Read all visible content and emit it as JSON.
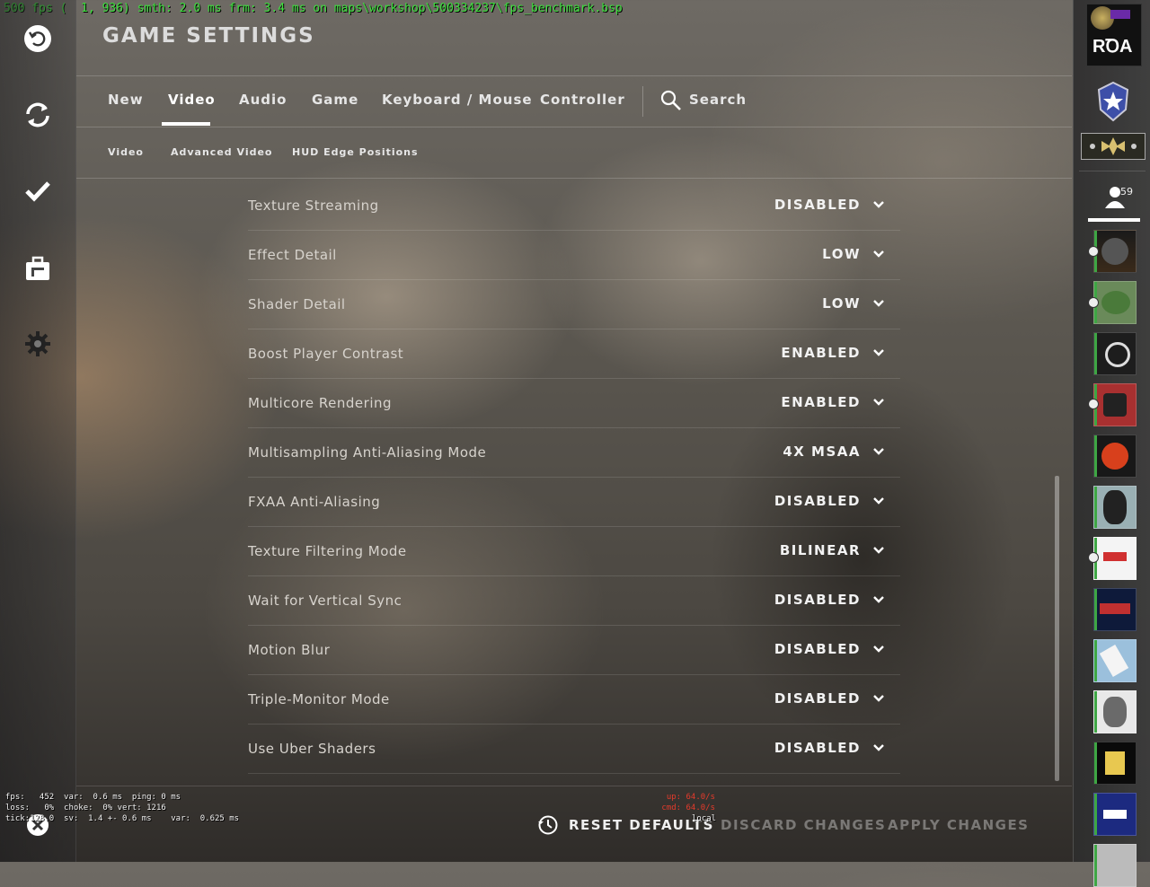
{
  "debug_overlay": "500 fps (  1, 936) smth: 2.0 ms frm: 3.4 ms on maps\\workshop\\500334237\\fps_benchmark.bsp",
  "title": "GAME SETTINGS",
  "tabs": [
    {
      "label": "New"
    },
    {
      "label": "Video",
      "active": true
    },
    {
      "label": "Audio"
    },
    {
      "label": "Game"
    },
    {
      "label": "Keyboard / Mouse"
    },
    {
      "label": "Controller"
    }
  ],
  "search": {
    "label": "Search",
    "icon": "search-icon"
  },
  "subtabs": [
    {
      "label": "Video"
    },
    {
      "label": "Advanced Video",
      "active": true
    },
    {
      "label": "HUD Edge Positions"
    }
  ],
  "settings": [
    {
      "label": "Texture Streaming",
      "value": "DISABLED"
    },
    {
      "label": "Effect Detail",
      "value": "LOW"
    },
    {
      "label": "Shader Detail",
      "value": "LOW"
    },
    {
      "label": "Boost Player Contrast",
      "value": "ENABLED"
    },
    {
      "label": "Multicore Rendering",
      "value": "ENABLED"
    },
    {
      "label": "Multisampling Anti-Aliasing Mode",
      "value": "4X MSAA"
    },
    {
      "label": "FXAA Anti-Aliasing",
      "value": "DISABLED"
    },
    {
      "label": "Texture Filtering Mode",
      "value": "BILINEAR"
    },
    {
      "label": "Wait for Vertical Sync",
      "value": "DISABLED"
    },
    {
      "label": "Motion Blur",
      "value": "DISABLED"
    },
    {
      "label": "Triple-Monitor Mode",
      "value": "DISABLED"
    },
    {
      "label": "Use Uber Shaders",
      "value": "DISABLED"
    }
  ],
  "buttons": {
    "reset": "RESET DEFAULTS",
    "discard": "DISCARD CHANGES",
    "apply": "APPLY CHANGES"
  },
  "netgraph": {
    "left": "fps:   452  var:  0.6 ms  ping: 0 ms\nloss:   0%  choke:  0% vert: 1216\ntick:128.0  sv:  1.4 +- 0.6 ms    var:  0.625 ms",
    "right": "up: 64.0/s\ncmd: 64.0/s",
    "local": "local"
  },
  "friends": {
    "online_count": "59"
  },
  "left_nav_icons": [
    "back-icon",
    "refresh-icon",
    "checkmark-icon",
    "inventory-icon",
    "settings-gear-icon",
    "power-icon"
  ],
  "colors": {
    "accent": "#ffffff",
    "debug_green": "#3ee03e",
    "netgraph_red": "#e53b2c",
    "online": "#3ea644"
  }
}
